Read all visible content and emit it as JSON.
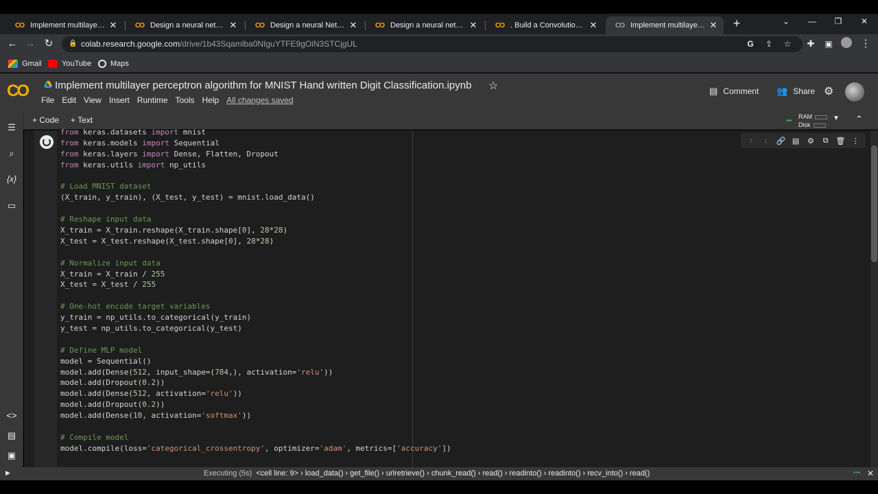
{
  "browser": {
    "tabs": [
      {
        "title": "Implement multilayer perce",
        "active": false
      },
      {
        "title": "Design a neural network fo",
        "active": false
      },
      {
        "title": "Design a neural Network fo",
        "active": false
      },
      {
        "title": "Design a neural network fo",
        "active": false
      },
      {
        "title": ". Build a Convolution Neura",
        "active": false
      },
      {
        "title": "Implement multilayer perce",
        "active": true
      }
    ],
    "tab_close": "✕",
    "new_tab": "+",
    "url_host": "colab.research.google.com",
    "url_path": "/drive/1b43Sqamlba0NIguYTFE9gOiN3STCjgUL",
    "bookmarks": [
      {
        "label": "Gmail",
        "icon": "gmail-icon"
      },
      {
        "label": "YouTube",
        "icon": "youtube-icon"
      },
      {
        "label": "Maps",
        "icon": "maps-icon"
      }
    ]
  },
  "colab": {
    "logo": "CO",
    "title": "Implement multilayer perceptron algorithm for MNIST Hand written Digit Classification.ipynb",
    "menu": [
      "File",
      "Edit",
      "View",
      "Insert",
      "Runtime",
      "Tools",
      "Help"
    ],
    "save_status": "All changes saved",
    "comment_label": "Comment",
    "share_label": "Share",
    "add_code_label": "+ Code",
    "add_text_label": "+ Text",
    "ram_label": "RAM",
    "disk_label": "Disk"
  },
  "code_lines": [
    [
      {
        "t": "from",
        "c": "kw"
      },
      {
        "t": " keras.datasets "
      },
      {
        "t": "import",
        "c": "kw"
      },
      {
        "t": " mnist"
      }
    ],
    [
      {
        "t": "from",
        "c": "kw"
      },
      {
        "t": " keras.models "
      },
      {
        "t": "import",
        "c": "kw"
      },
      {
        "t": " Sequential"
      }
    ],
    [
      {
        "t": "from",
        "c": "kw"
      },
      {
        "t": " keras.layers "
      },
      {
        "t": "import",
        "c": "kw"
      },
      {
        "t": " Dense, Flatten, Dropout"
      }
    ],
    [
      {
        "t": "from",
        "c": "kw"
      },
      {
        "t": " keras.utils "
      },
      {
        "t": "import",
        "c": "kw"
      },
      {
        "t": " np_utils"
      }
    ],
    [],
    [
      {
        "t": "# Load MNIST dataset",
        "c": "cmt"
      }
    ],
    [
      {
        "t": "(X_train, y_train), (X_test, y_test) = mnist.load_data()"
      }
    ],
    [],
    [
      {
        "t": "# Reshape input data",
        "c": "cmt"
      }
    ],
    [
      {
        "t": "X_train = X_train.reshape(X_train.shape["
      },
      {
        "t": "0",
        "c": "num"
      },
      {
        "t": "], "
      },
      {
        "t": "28",
        "c": "num"
      },
      {
        "t": "*"
      },
      {
        "t": "28",
        "c": "num"
      },
      {
        "t": ")"
      }
    ],
    [
      {
        "t": "X_test = X_test.reshape(X_test.shape["
      },
      {
        "t": "0",
        "c": "num"
      },
      {
        "t": "], "
      },
      {
        "t": "28",
        "c": "num"
      },
      {
        "t": "*"
      },
      {
        "t": "28",
        "c": "num"
      },
      {
        "t": ")"
      }
    ],
    [],
    [
      {
        "t": "# Normalize input data",
        "c": "cmt"
      }
    ],
    [
      {
        "t": "X_train = X_train / "
      },
      {
        "t": "255",
        "c": "num"
      }
    ],
    [
      {
        "t": "X_test = X_test / "
      },
      {
        "t": "255",
        "c": "num"
      }
    ],
    [],
    [
      {
        "t": "# One-hot encode target variables",
        "c": "cmt"
      }
    ],
    [
      {
        "t": "y_train = np_utils.to_categorical(y_train)"
      }
    ],
    [
      {
        "t": "y_test = np_utils.to_categorical(y_test)"
      }
    ],
    [],
    [
      {
        "t": "# Define MLP model",
        "c": "cmt"
      }
    ],
    [
      {
        "t": "model = Sequential()"
      }
    ],
    [
      {
        "t": "model.add(Dense("
      },
      {
        "t": "512",
        "c": "num"
      },
      {
        "t": ", input_shape=("
      },
      {
        "t": "784",
        "c": "num"
      },
      {
        "t": ",), activation="
      },
      {
        "t": "'relu'",
        "c": "str"
      },
      {
        "t": "))"
      }
    ],
    [
      {
        "t": "model.add(Dropout("
      },
      {
        "t": "0.2",
        "c": "num"
      },
      {
        "t": "))"
      }
    ],
    [
      {
        "t": "model.add(Dense("
      },
      {
        "t": "512",
        "c": "num"
      },
      {
        "t": ", activation="
      },
      {
        "t": "'relu'",
        "c": "str"
      },
      {
        "t": "))"
      }
    ],
    [
      {
        "t": "model.add(Dropout("
      },
      {
        "t": "0.2",
        "c": "num"
      },
      {
        "t": "))"
      }
    ],
    [
      {
        "t": "model.add(Dense("
      },
      {
        "t": "10",
        "c": "num"
      },
      {
        "t": ", activation="
      },
      {
        "t": "'softmax'",
        "c": "str"
      },
      {
        "t": "))"
      }
    ],
    [],
    [
      {
        "t": "# Compile model",
        "c": "cmt"
      }
    ],
    [
      {
        "t": "model.compile(loss="
      },
      {
        "t": "'categorical_crossentropy'",
        "c": "str"
      },
      {
        "t": ", optimizer="
      },
      {
        "t": "'adam'",
        "c": "str"
      },
      {
        "t": ", metrics=["
      },
      {
        "t": "'accuracy'",
        "c": "str"
      },
      {
        "t": "])"
      }
    ]
  ],
  "status": {
    "executing": "Executing (5s)",
    "trace": "<cell line: 9> › load_data() › get_file() › urlretrieve() › chunk_read() › read() › readinto() › readinto() › recv_into() › read()"
  }
}
